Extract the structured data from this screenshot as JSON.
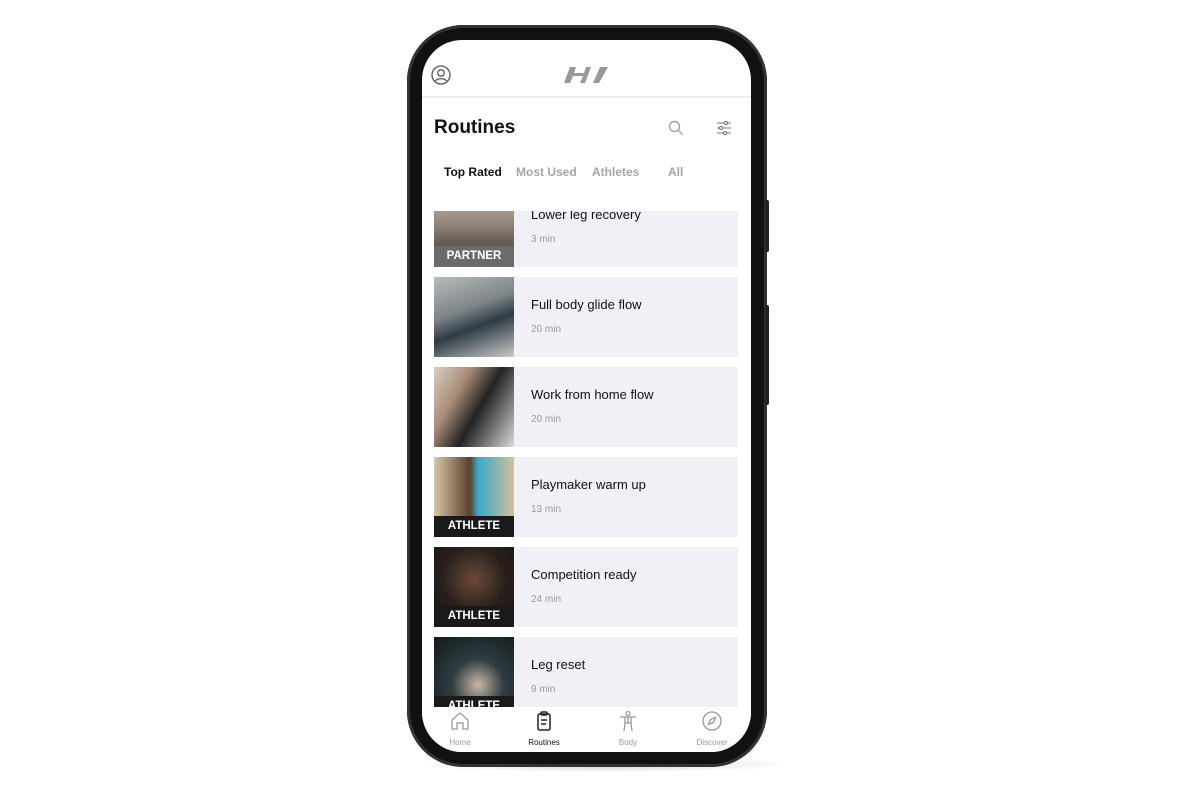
{
  "header": {
    "profile_icon": "user-circle-icon",
    "logo_icon": "hyperice-logo"
  },
  "page": {
    "title": "Routines",
    "search_icon": "search-icon",
    "filter_icon": "sliders-icon"
  },
  "tabs": [
    {
      "label": "Top Rated",
      "active": true
    },
    {
      "label": "Most Used"
    },
    {
      "label": "Athletes"
    },
    {
      "label": "All"
    }
  ],
  "routines": [
    {
      "name": "Lower leg recovery",
      "duration": "3 min",
      "badge": "PARTNER"
    },
    {
      "name": "Full body glide flow",
      "duration": "20 min",
      "badge": ""
    },
    {
      "name": "Work from home flow",
      "duration": "20 min",
      "badge": ""
    },
    {
      "name": "Playmaker warm up",
      "duration": "13 min",
      "badge": "ATHLETE"
    },
    {
      "name": "Competition ready",
      "duration": "24 min",
      "badge": "ATHLETE"
    },
    {
      "name": "Leg reset",
      "duration": "9 min",
      "badge": "ATHLETE"
    }
  ],
  "nav": [
    {
      "label": "Home",
      "icon": "home-icon"
    },
    {
      "label": "Routines",
      "icon": "clipboard-icon",
      "active": true
    },
    {
      "label": "Body",
      "icon": "body-icon"
    },
    {
      "label": "Discover",
      "icon": "compass-icon"
    }
  ],
  "colors": {
    "card_bg": "#f1f0f6",
    "partner_badge": "#6b6b6b",
    "athlete_badge": "#1a1a1a",
    "inactive": "#a6a6a6"
  }
}
